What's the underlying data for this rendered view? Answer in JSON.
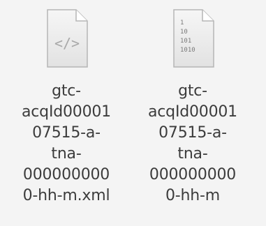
{
  "files": [
    {
      "icon": "xml-code-file-icon",
      "icon_glyph": "</>",
      "name_lines": [
        "gtc-",
        "acqId00001",
        "07515-a-",
        "tna-",
        "000000000",
        "0-hh-m.xml"
      ]
    },
    {
      "icon": "binary-file-icon",
      "icon_glyph_lines": [
        "1",
        "10",
        "101",
        "1010"
      ],
      "name_lines": [
        "gtc-",
        "acqId00001",
        "07515-a-",
        "tna-",
        "000000000",
        "0-hh-m"
      ]
    }
  ],
  "colors": {
    "background": "#f4f4f4",
    "label_text": "#3c3c3c",
    "icon_paper": "#e9e9e9",
    "icon_border": "#b5b5b5",
    "icon_glyph": "#a8a8a8"
  }
}
